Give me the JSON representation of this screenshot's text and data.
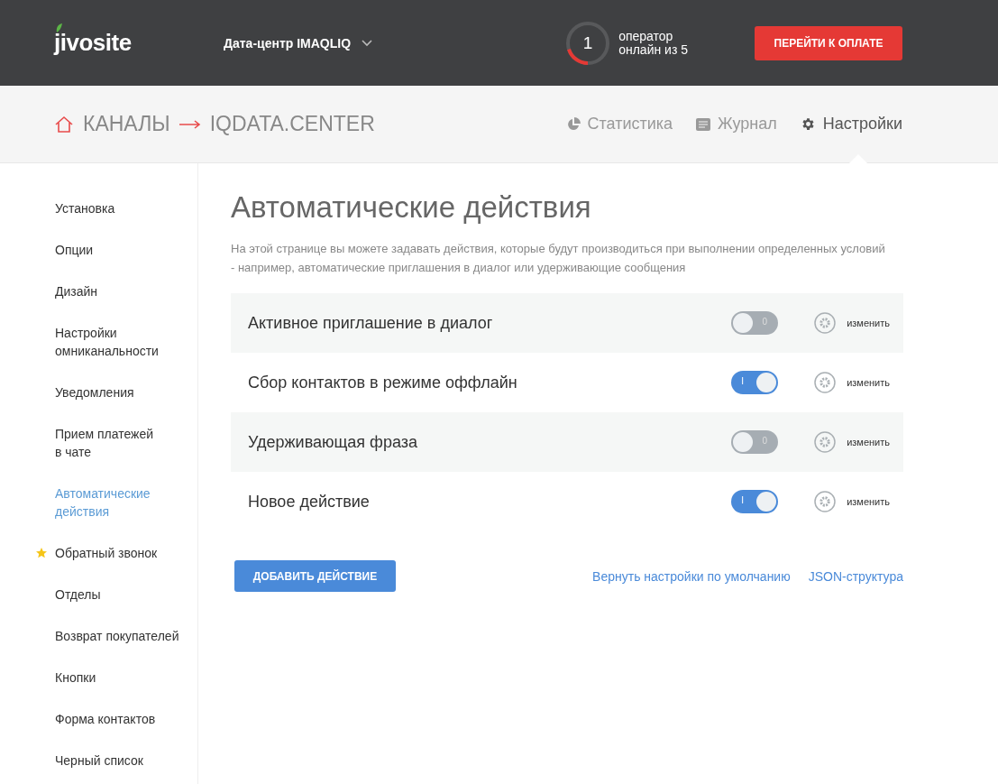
{
  "header": {
    "logo": "jivosite",
    "datacenter": "Дата-центр IMAQLIQ",
    "operators": {
      "count": "1",
      "level": 0.2,
      "caption": "оператор\nонлайн из 5"
    },
    "pay_button": "ПЕРЕЙТИ К ОПЛАТЕ"
  },
  "breadcrumb": {
    "root": "КАНАЛЫ",
    "current": "IQDATA.CENTER"
  },
  "tabs": [
    {
      "label": "Статистика",
      "kind": "stats",
      "selected": false
    },
    {
      "label": "Журнал",
      "kind": "log",
      "selected": false
    },
    {
      "label": "Настройки",
      "kind": "settings",
      "selected": true
    }
  ],
  "sidebar": {
    "items": [
      {
        "label": "Установка",
        "selected": false,
        "starred": false
      },
      {
        "label": "Опции",
        "selected": false,
        "starred": false
      },
      {
        "label": "Дизайн",
        "selected": false,
        "starred": false
      },
      {
        "label": "Настройки\nомниканальности",
        "selected": false,
        "starred": false
      },
      {
        "label": "Уведомления",
        "selected": false,
        "starred": false
      },
      {
        "label": "Прием платежей\nв чате",
        "selected": false,
        "starred": false
      },
      {
        "label": "Автоматические\nдействия",
        "selected": true,
        "starred": false
      },
      {
        "label": "Обратный звонок",
        "selected": false,
        "starred": true
      },
      {
        "label": "Отделы",
        "selected": false,
        "starred": false
      },
      {
        "label": "Возврат покупателей",
        "selected": false,
        "starred": false
      },
      {
        "label": "Кнопки",
        "selected": false,
        "starred": false
      },
      {
        "label": "Форма контактов",
        "selected": false,
        "starred": false
      },
      {
        "label": "Черный список",
        "selected": false,
        "starred": false
      }
    ]
  },
  "page": {
    "title": "Автоматические действия",
    "description": "На этой странице вы можете задавать действия, которые будут производиться при выполнении определенных условий - например, автоматические приглашения в диалог или удерживающие сообщения"
  },
  "actions": [
    {
      "name": "Активное приглашение в диалог",
      "on": false,
      "switch_text": "0",
      "edit": "изменить"
    },
    {
      "name": "Сбор контактов в режиме оффлайн",
      "on": true,
      "switch_text": "I",
      "edit": "изменить"
    },
    {
      "name": "Удерживающая фраза",
      "on": false,
      "switch_text": "0",
      "edit": "изменить"
    },
    {
      "name": "Новое действие",
      "on": true,
      "switch_text": "I",
      "edit": "изменить"
    }
  ],
  "footer": {
    "add_button": "ДОБАВИТЬ ДЕЙСТВИЕ",
    "links": [
      "Вернуть настройки по умолчанию",
      "JSON-структура"
    ]
  }
}
